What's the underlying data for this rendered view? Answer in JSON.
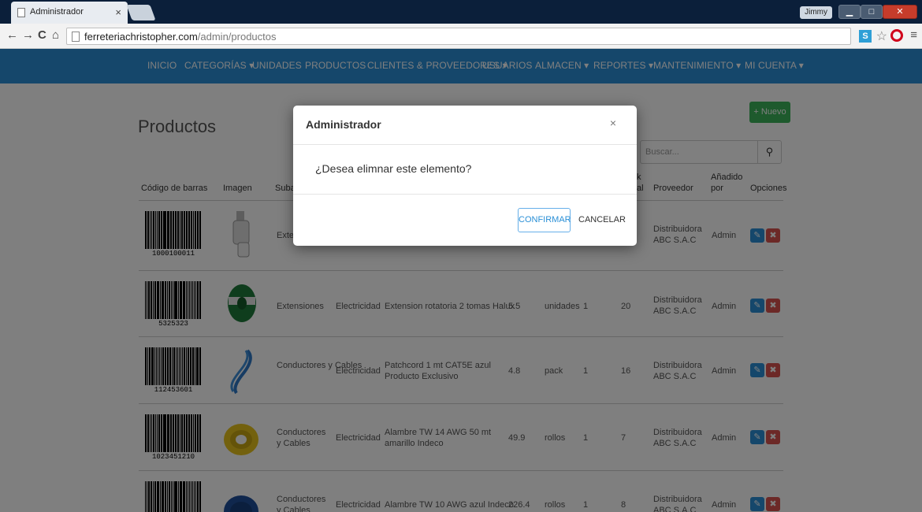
{
  "browser": {
    "tab_title": "Administrador",
    "tab_close": "×",
    "user_chip": "Jimmy",
    "url_host": "ferreteriachristopher.com",
    "url_path": "/admin/productos",
    "ext_s": "S"
  },
  "nav": {
    "items": [
      "INICIO",
      "CATEGORÍAS ▾",
      "UNIDADES",
      "PRODUCTOS",
      "CLIENTES & PROVEEDORES ▾",
      "USUARIOS",
      "ALMACEN ▾",
      "REPORTES ▾",
      "MANTENIMIENTO ▾",
      "MI CUENTA ▾"
    ]
  },
  "page": {
    "title": "Productos",
    "new_button": "Nuevo",
    "search_placeholder": "Buscar..."
  },
  "table": {
    "headers": {
      "barcode": "Código de barras",
      "image": "Imagen",
      "subcat": "Suba",
      "stock_k": "k",
      "stock_al": "al",
      "proveedor": "Proveedor",
      "added_1": "Añadido",
      "added_2": "por",
      "options": "Opciones"
    },
    "rows": [
      {
        "barcode": "1000100011",
        "subcat": "Exte",
        "category": "",
        "name": "",
        "price": "",
        "unit": "",
        "min": "",
        "stock": "",
        "supplier_1": "Distribuidora",
        "supplier_2": "ABC S.A.C",
        "added_by": "Admin"
      },
      {
        "barcode": "5325323",
        "subcat": "Extensiones",
        "category": "Electricidad",
        "name": "Extension rotatoria 2 tomas Halux",
        "price": "5.5",
        "unit": "unidades",
        "min": "1",
        "stock": "20",
        "supplier_1": "Distribuidora",
        "supplier_2": "ABC S.A.C",
        "added_by": "Admin"
      },
      {
        "barcode": "112453601",
        "subcat": "Conductores y Cables",
        "category": "Electricidad",
        "name": "Patchcord 1 mt CAT5E azul Producto Exclusivo",
        "price": "4.8",
        "unit": "pack",
        "min": "1",
        "stock": "16",
        "supplier_1": "Distribuidora",
        "supplier_2": "ABC S.A.C",
        "added_by": "Admin"
      },
      {
        "barcode": "1023451210",
        "subcat": "Conductores y Cables",
        "category": "Electricidad",
        "name": "Alambre TW 14 AWG 50 mt amarillo Indeco",
        "price": "49.9",
        "unit": "rollos",
        "min": "1",
        "stock": "7",
        "supplier_1": "Distribuidora",
        "supplier_2": "ABC S.A.C",
        "added_by": "Admin"
      },
      {
        "barcode": "",
        "subcat": "Conductores y Cables",
        "category": "Electricidad",
        "name": "Alambre TW 10 AWG azul Indeco",
        "price": "226.4",
        "unit": "rollos",
        "min": "1",
        "stock": "8",
        "supplier_1": "Distribuidora",
        "supplier_2": "ABC S.A.C",
        "added_by": "Admin"
      }
    ]
  },
  "modal": {
    "title": "Administrador",
    "close": "×",
    "message": "¿Desea elimnar este elemento?",
    "confirm": "CONFIRMAR",
    "cancel": "CANCELAR"
  },
  "colors": {
    "navbar": "#2a8fd6",
    "new_button": "#3cb55a",
    "edit_button": "#2a8fd6",
    "delete_button": "#d9534f"
  }
}
